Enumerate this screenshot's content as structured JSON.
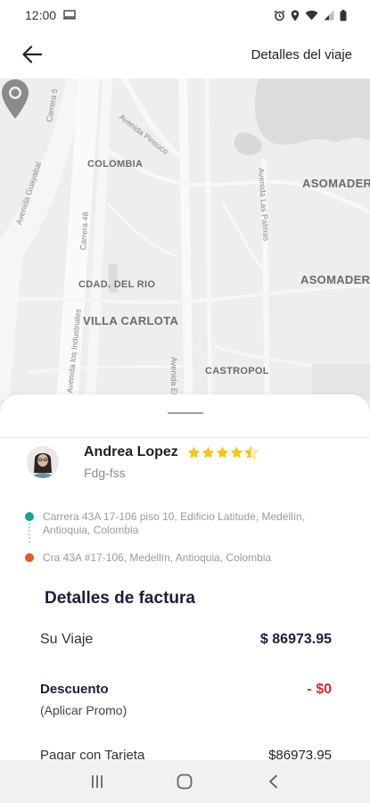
{
  "status_bar": {
    "time": "12:00",
    "icons": [
      "screenshot-icon",
      "alarm-icon",
      "location-icon",
      "wifi-icon",
      "signal-icon",
      "battery-icon"
    ]
  },
  "app_bar": {
    "back_icon": "arrow-left-icon",
    "title": "Detalles del viaje"
  },
  "map": {
    "labels": {
      "colombia": "COLOMBIA",
      "asomadera_1": "ASOMADERA",
      "asomadera_2": "ASOMADERA",
      "cdad_del_rio": "CDAD. DEL RIO",
      "villa_carlota": "VILLA CARLOTA",
      "castropol": "CASTROPOL"
    },
    "streets": {
      "carrera_5x": "Carrera 5",
      "avenida_pinsuco": "Avenida Pinsuco",
      "avenida_guayabal": "Avenida Guayabal",
      "carrera_48": "Carrera 48",
      "avenida_industriales": "Avenida los Industriales",
      "las_palmas": "Avenida Las Palmas",
      "avenida_el": "Avenida El"
    },
    "pin_icon": "map-pin-icon"
  },
  "driver": {
    "name": "Andrea Lopez",
    "subtitle": "Fdg-fss",
    "rating": 4.5,
    "star_color": "#f5c518"
  },
  "route": {
    "origin": "Carrera 43A 17-106 piso 10, Edificio Latitude, Medellín, Antioquia, Colombia",
    "destination": "Cra 43A #17-106, Medellín, Antioquia, Colombia",
    "origin_color": "#1aa394",
    "destination_color": "#e8562a"
  },
  "invoice": {
    "title": "Detalles de factura",
    "trip_label": "Su Viaje",
    "trip_value": "$ 86973.95",
    "discount_label": "Descuento",
    "discount_value": "- $0",
    "promo_label": "(Aplicar Promo)",
    "pay_label": "Pagar con Tarjeta",
    "pay_value": "$86973.95"
  },
  "nav_bar": {
    "recents_icon": "recent-apps-icon",
    "home_icon": "home-icon",
    "back_icon": "back-icon"
  }
}
